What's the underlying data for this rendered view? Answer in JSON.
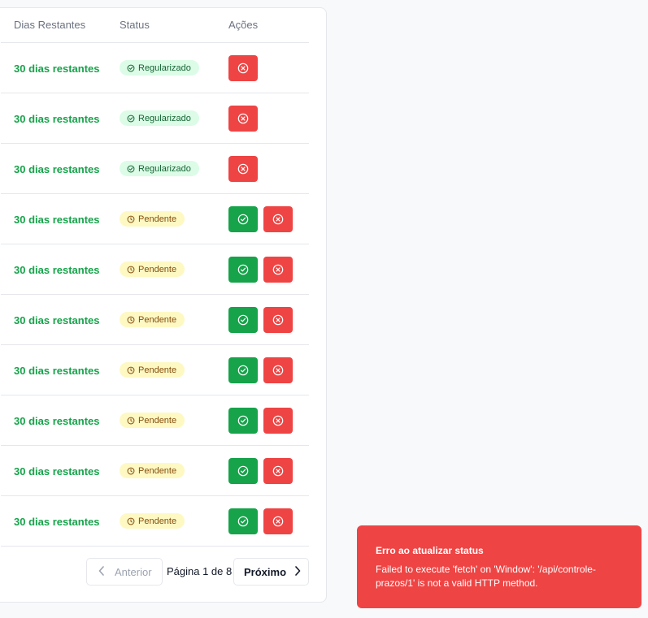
{
  "table": {
    "headers": [
      "Dias Restantes",
      "Status",
      "Ações"
    ],
    "rows": [
      {
        "days": "30 dias restantes",
        "status": "Regularizado",
        "status_kind": "regularizado"
      },
      {
        "days": "30 dias restantes",
        "status": "Regularizado",
        "status_kind": "regularizado"
      },
      {
        "days": "30 dias restantes",
        "status": "Regularizado",
        "status_kind": "regularizado"
      },
      {
        "days": "30 dias restantes",
        "status": "Pendente",
        "status_kind": "pendente"
      },
      {
        "days": "30 dias restantes",
        "status": "Pendente",
        "status_kind": "pendente"
      },
      {
        "days": "30 dias restantes",
        "status": "Pendente",
        "status_kind": "pendente"
      },
      {
        "days": "30 dias restantes",
        "status": "Pendente",
        "status_kind": "pendente"
      },
      {
        "days": "30 dias restantes",
        "status": "Pendente",
        "status_kind": "pendente"
      },
      {
        "days": "30 dias restantes",
        "status": "Pendente",
        "status_kind": "pendente"
      },
      {
        "days": "30 dias restantes",
        "status": "Pendente",
        "status_kind": "pendente"
      }
    ]
  },
  "pagination": {
    "prev_label": "Anterior",
    "info": "Página 1 de 8",
    "next_label": "Próximo"
  },
  "toast": {
    "title": "Erro ao atualizar status",
    "message": "Failed to execute 'fetch' on 'Window': '/api/controle-prazos/1' is not a valid HTTP method."
  },
  "icons": {
    "approve": "check-circle-icon",
    "reject": "x-circle-icon",
    "regularizado": "check-circle-icon",
    "pendente": "clock-icon",
    "prev": "chevron-left-icon",
    "next": "chevron-right-icon"
  },
  "colors": {
    "days_text": "#16a34a",
    "approve_button": "#16a34a",
    "reject_button": "#ef4444",
    "badge_regularizado_bg": "#dcfce7",
    "badge_pendente_bg": "#fef9c3",
    "toast_bg": "#ef4444"
  }
}
